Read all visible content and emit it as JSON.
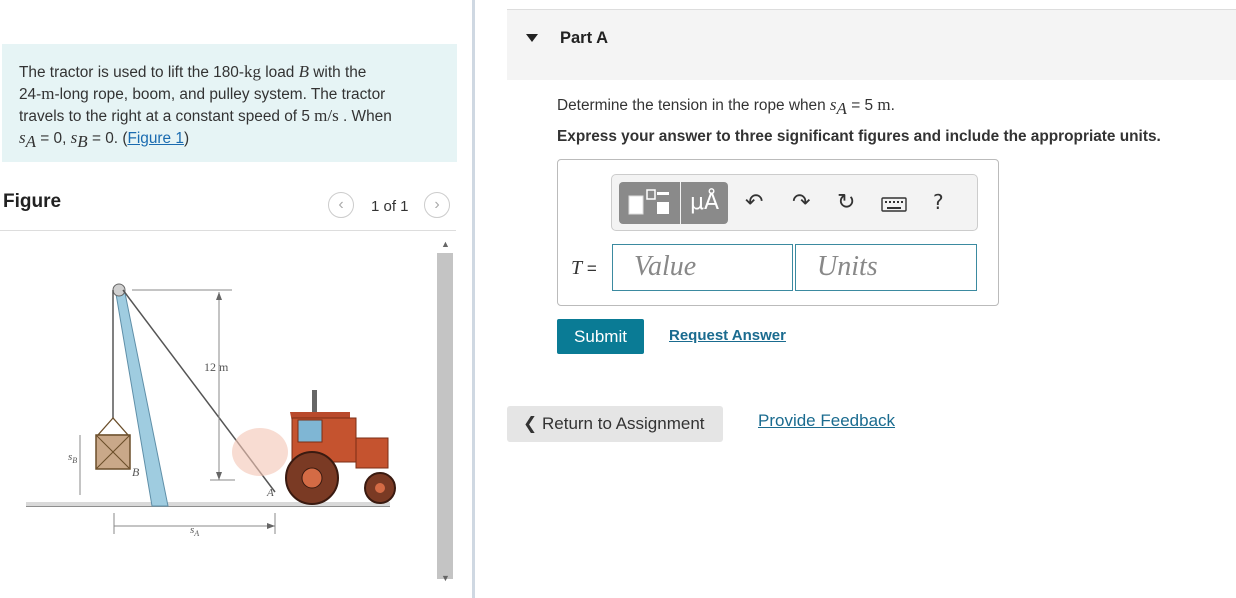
{
  "problem": {
    "t1": "The tractor is used to lift the 180-",
    "u1": "kg",
    "t2": " load ",
    "v1": "B",
    "t3": " with the",
    "u2": "m",
    "t4": "-long rope, boom, and pulley system. The tractor",
    "t5": "travels to the right at a constant speed of 5  ",
    "u3": "m/s",
    "t6": " . When",
    "n24": "24-",
    "sA": "s",
    "sAsub": "A",
    "eq0a": " = 0, ",
    "sB": "s",
    "sBsub": "B",
    "eq0b": " = 0. (",
    "figlink": "Figure 1",
    "close": ")"
  },
  "figure": {
    "title": "Figure",
    "pager": "1 of 1",
    "prev_icon": "chevron-left-icon",
    "next_icon": "chevron-right-icon",
    "labels": {
      "height": "12 m",
      "sB": "s",
      "sBsub": "B",
      "B": "B",
      "A": "A",
      "sA": "s",
      "sAsub": "A"
    }
  },
  "part": {
    "title": "Part A",
    "q_text": "Determine the tension in the rope when ",
    "q_var": "s",
    "q_sub": "A",
    "q_eq": " = 5 ",
    "q_unit": "m",
    "q_end": ".",
    "instructions": "Express your answer to three significant figures and include the appropriate units."
  },
  "answer": {
    "label_var": "T",
    "label_eq": " =",
    "value_placeholder": "Value",
    "units_placeholder": "Units",
    "toolbar": {
      "templates_icon": "templates-icon",
      "units_label": "μÅ",
      "undo_icon": "undo-icon",
      "redo_icon": "redo-icon",
      "reset_icon": "reset-icon",
      "keyboard_icon": "keyboard-icon",
      "help_label": "?"
    }
  },
  "actions": {
    "submit": "Submit",
    "request_answer": "Request Answer",
    "return": "Return to Assignment",
    "feedback": "Provide Feedback"
  },
  "colors": {
    "submit_bg": "#0a7b95",
    "problem_bg": "#e6f4f5",
    "link": "#1a6b8f"
  }
}
